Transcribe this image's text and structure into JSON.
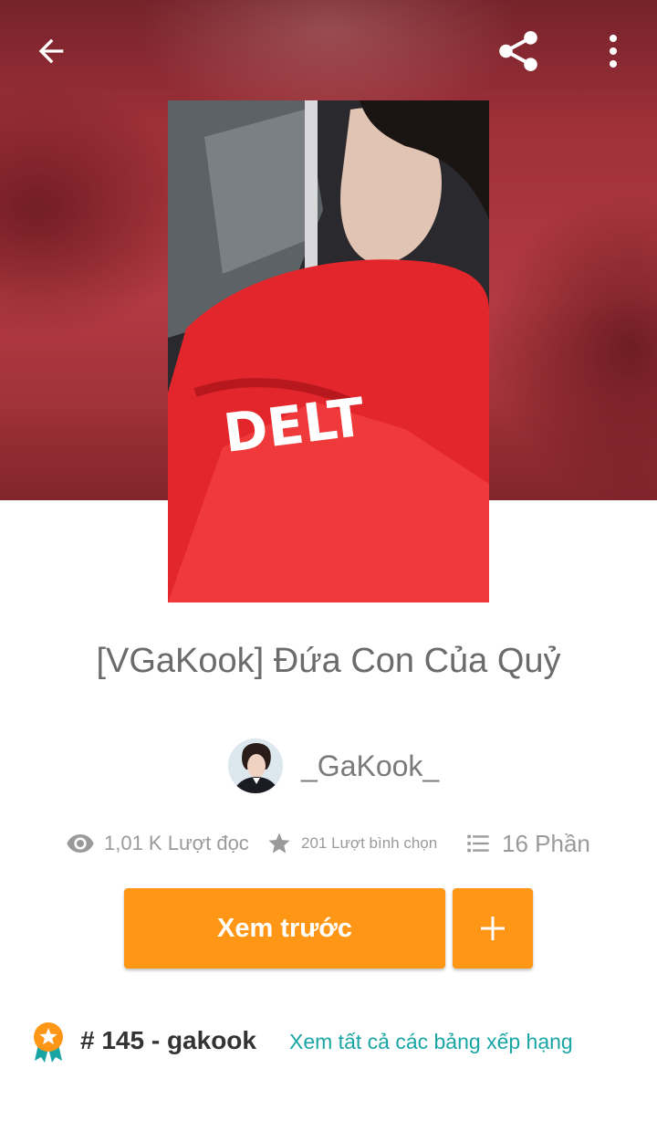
{
  "colors": {
    "accent": "#ff9616",
    "link": "#1aa5a5",
    "title_text": "#6b6b6b",
    "stat_text": "#9a9a9a",
    "header_red": "#a5333c"
  },
  "toolbar": {
    "back_icon": "arrow-left-icon",
    "share_icon": "share-icon",
    "more_icon": "more-vertical-icon"
  },
  "story": {
    "title": "[VGaKook] Đứa Con Của Quỷ",
    "author": "_GaKook_",
    "stats": {
      "reads": "1,01 K Lượt đọc",
      "votes": "201 Lượt bình chọn",
      "parts": "16 Phần"
    }
  },
  "actions": {
    "preview_label": "Xem trước",
    "add_icon": "plus-icon"
  },
  "ranking": {
    "rank": "# 145 - gakook",
    "view_all": "Xem tất cả các bảng xếp hạng"
  }
}
